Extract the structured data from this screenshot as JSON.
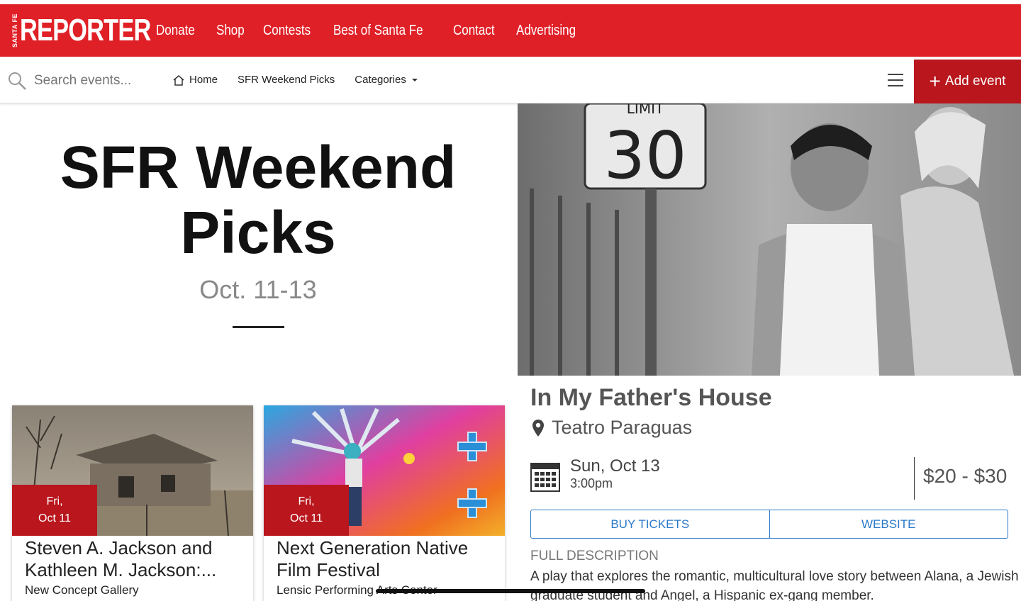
{
  "brand": {
    "small": "SANTA FE",
    "main": "REPORTER",
    "color": "#e02027"
  },
  "topnav": [
    "Donate",
    "Shop",
    "Contests",
    "Best of Santa Fe",
    "Contact",
    "Advertising"
  ],
  "search": {
    "placeholder": "Search events..."
  },
  "subnav": {
    "home": "Home",
    "picks": "SFR Weekend Picks",
    "categories": "Categories"
  },
  "add_event": "Add event",
  "page": {
    "title": "SFR Weekend Picks",
    "date_range": "Oct. 11-13"
  },
  "cards": [
    {
      "day": "Fri,",
      "date": "Oct 11",
      "title": "Steven A. Jackson and Kathleen M. Jackson:...",
      "venue": "New Concept Gallery"
    },
    {
      "day": "Fri,",
      "date": "Oct 11",
      "title": "Next Generation Native Film Festival",
      "venue": "Lensic Performing Arts Center"
    }
  ],
  "event": {
    "title": "In My Father's House",
    "venue": "Teatro Paraguas",
    "day": "Sun, Oct 13",
    "time": "3:00pm",
    "price": "$20 - $30",
    "buy_tickets": "BUY TICKETS",
    "website": "WEBSITE",
    "description_label": "FULL DESCRIPTION",
    "description": "A play that explores the romantic, multicultural love story between Alana, a Jewish graduate student and Angel, a Hispanic ex-gang member.",
    "sign_text": "30",
    "sign_top_text": "LIMIT"
  },
  "colors": {
    "accent": "#e02027",
    "accent_dark": "#b9161d",
    "link": "#2b79c9"
  }
}
